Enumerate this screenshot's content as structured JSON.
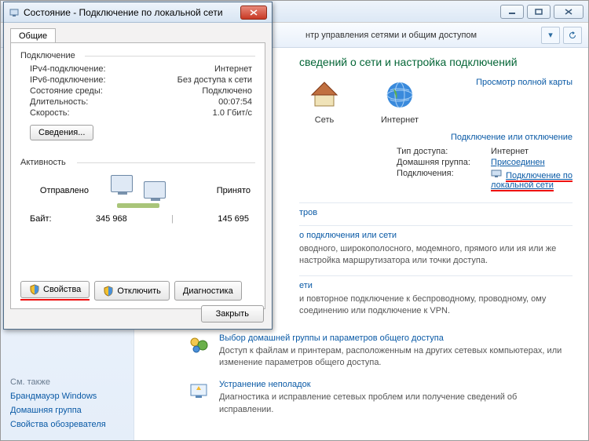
{
  "bg": {
    "crumb": "нтр управления сетями и общим доступом",
    "heading": "сведений о сети и настройка подключений",
    "map_link": "Просмотр полной карты",
    "map": {
      "net": "Сеть",
      "internet": "Интернет"
    },
    "conn_heading": "Подключение или отключение",
    "conn": {
      "access_label": "Тип доступа:",
      "access_value": "Интернет",
      "home_label": "Домашняя группа:",
      "home_value": "Присоединен",
      "conns_label": "Подключения:",
      "conns_value1": "Подключение по",
      "conns_value2": "локальной сети"
    },
    "sec1_link": "тров",
    "sec2_link": "о подключения или сети",
    "sec2_txt": "оводного, широкополосного, модемного, прямого или ия или же настройка маршрутизатора или точки доступа.",
    "sec3_link": "ети",
    "sec3_txt": "и повторное подключение к беспроводному, проводному, ому соединению или подключение к VPN.",
    "items": [
      {
        "link": "Выбор домашней группы и параметров общего доступа",
        "txt": "Доступ к файлам и принтерам, расположенным на других сетевых компьютерах, или изменение параметров общего доступа."
      },
      {
        "link": "Устранение неполадок",
        "txt": "Диагностика и исправление сетевых проблем или получение сведений об исправлении."
      }
    ],
    "sidebar": {
      "see": "См. также",
      "links": [
        "Брандмауэр Windows",
        "Домашняя группа",
        "Свойства обозревателя"
      ]
    }
  },
  "dlg": {
    "title": "Состояние - Подключение по локальной сети",
    "tab": "Общие",
    "group_conn": "Подключение",
    "rows": [
      {
        "k": "IPv4-подключение:",
        "v": "Интернет"
      },
      {
        "k": "IPv6-подключение:",
        "v": "Без доступа к сети"
      },
      {
        "k": "Состояние среды:",
        "v": "Подключено"
      },
      {
        "k": "Длительность:",
        "v": "00:07:54"
      },
      {
        "k": "Скорость:",
        "v": "1.0 Гбит/с"
      }
    ],
    "details_btn": "Сведения...",
    "group_act": "Активность",
    "sent_label": "Отправлено",
    "recv_label": "Принято",
    "bytes_label": "Байт:",
    "sent_bytes": "345 968",
    "recv_bytes": "145 695",
    "btn_props": "Свойства",
    "btn_disable": "Отключить",
    "btn_diag": "Диагностика",
    "btn_close": "Закрыть"
  }
}
